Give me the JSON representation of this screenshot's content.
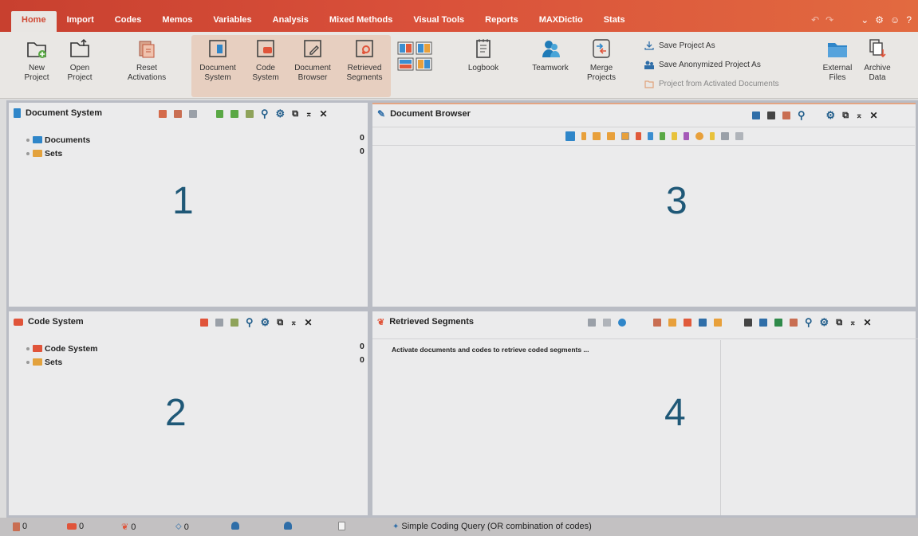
{
  "menu": {
    "tabs": [
      "Home",
      "Import",
      "Codes",
      "Memos",
      "Variables",
      "Analysis",
      "Mixed Methods",
      "Visual Tools",
      "Reports",
      "MAXDictio",
      "Stats"
    ],
    "active_tab": "Home"
  },
  "ribbon": {
    "new_project": [
      "New",
      "Project"
    ],
    "open_project": [
      "Open",
      "Project"
    ],
    "reset_activations": [
      "Reset",
      "Activations"
    ],
    "document_system": [
      "Document",
      "System"
    ],
    "code_system": [
      "Code",
      "System"
    ],
    "document_browser": [
      "Document",
      "Browser"
    ],
    "retrieved_segments": [
      "Retrieved",
      "Segments"
    ],
    "logbook": "Logbook",
    "teamwork": "Teamwork",
    "merge_projects": [
      "Merge",
      "Projects"
    ],
    "save_project_as": "Save Project As",
    "save_anonymized": "Save Anonymized Project As",
    "project_from_activated": "Project from Activated Documents",
    "external_files": [
      "External",
      "Files"
    ],
    "archive_data": [
      "Archive",
      "Data"
    ]
  },
  "panels": {
    "document_system": {
      "title": "Document System",
      "number": "1",
      "tree": [
        {
          "label": "Documents",
          "count": "0"
        },
        {
          "label": "Sets",
          "count": "0"
        }
      ]
    },
    "code_system": {
      "title": "Code System",
      "number": "2",
      "tree": [
        {
          "label": "Code System",
          "count": "0"
        },
        {
          "label": "Sets",
          "count": "0"
        }
      ]
    },
    "document_browser": {
      "title": "Document Browser",
      "number": "3"
    },
    "retrieved_segments": {
      "title": "Retrieved Segments",
      "number": "4",
      "message": "Activate documents and codes to retrieve coded segments ..."
    }
  },
  "status": {
    "docs": "0",
    "codes": "0",
    "segments": "0",
    "variables": "0",
    "query": "Simple Coding Query (OR combination of codes)"
  },
  "colors": {
    "accent": "#d9503a",
    "panel_border": "#b9bcc4",
    "number": "#1f5877"
  }
}
